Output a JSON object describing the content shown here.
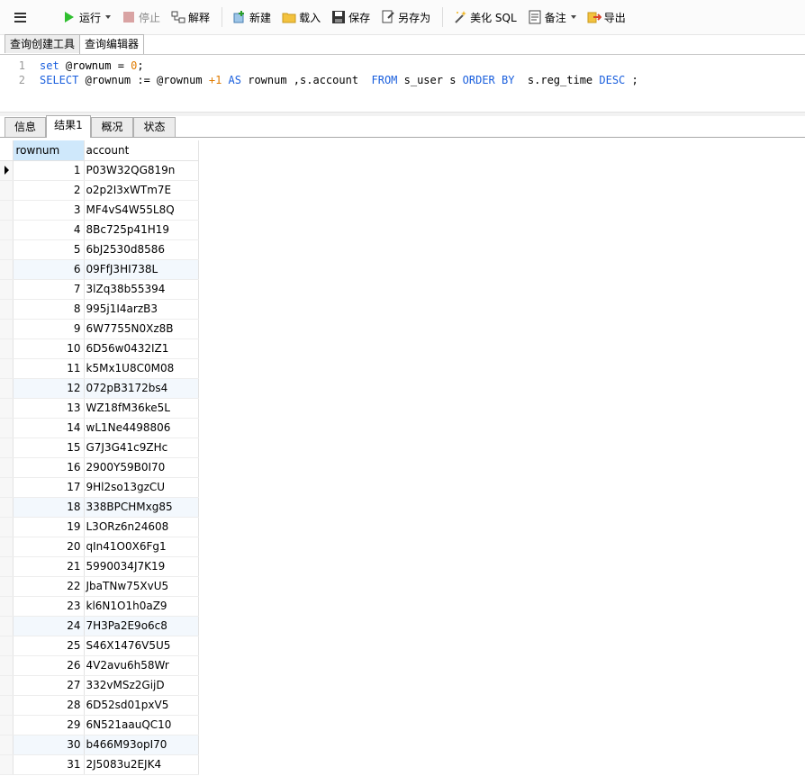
{
  "toolbar": {
    "run_label": "运行",
    "stop_label": "停止",
    "explain_label": "解释",
    "new_label": "新建",
    "load_label": "载入",
    "save_label": "保存",
    "save_as_label": "另存为",
    "beautify_label": "美化 SQL",
    "comment_label": "备注",
    "export_label": "导出"
  },
  "outer_tabs": [
    "查询创建工具",
    "查询编辑器"
  ],
  "editor": {
    "line_numbers": [
      "1",
      "2"
    ]
  },
  "result_tabs": [
    "信息",
    "结果1",
    "概况",
    "状态"
  ],
  "grid": {
    "columns": [
      "rownum",
      "account"
    ],
    "rows": [
      [
        "1",
        "P03W32QG819n"
      ],
      [
        "2",
        "o2p2I3xWTm7E"
      ],
      [
        "3",
        "MF4vS4W55L8Q"
      ],
      [
        "4",
        "8Bc725p41H19"
      ],
      [
        "5",
        "6bJ2530d8586"
      ],
      [
        "6",
        "09FfJ3HI738L"
      ],
      [
        "7",
        "3lZq38b55394"
      ],
      [
        "8",
        "995j1I4arzB3"
      ],
      [
        "9",
        "6W7755N0Xz8B"
      ],
      [
        "10",
        "6D56w0432IZ1"
      ],
      [
        "11",
        "k5Mx1U8C0M08"
      ],
      [
        "12",
        "072pB3172bs4"
      ],
      [
        "13",
        "WZ18fM36ke5L"
      ],
      [
        "14",
        "wL1Ne4498806"
      ],
      [
        "15",
        "G7J3G41c9ZHc"
      ],
      [
        "16",
        "2900Y59B0I70"
      ],
      [
        "17",
        "9Hl2so13gzCU"
      ],
      [
        "18",
        "338BPCHMxg85"
      ],
      [
        "19",
        "L3ORz6n24608"
      ],
      [
        "20",
        "qIn41O0X6Fg1"
      ],
      [
        "21",
        "5990034J7K19"
      ],
      [
        "22",
        "JbaTNw75XvU5"
      ],
      [
        "23",
        "kl6N1O1h0aZ9"
      ],
      [
        "24",
        "7H3Pa2E9o6c8"
      ],
      [
        "25",
        "S46X1476V5U5"
      ],
      [
        "26",
        "4V2avu6h58Wr"
      ],
      [
        "27",
        "332vMSz2GijD"
      ],
      [
        "28",
        "6D52sd01pxV5"
      ],
      [
        "29",
        "6N521aauQC10"
      ],
      [
        "30",
        "b466M93opI70"
      ],
      [
        "31",
        "2J5083u2EJK4"
      ]
    ]
  }
}
